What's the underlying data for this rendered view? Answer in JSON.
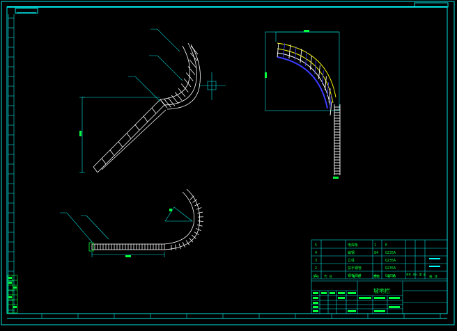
{
  "drawing": {
    "title_block_title": "坡地栏",
    "colors": {
      "background": "#000000",
      "frame": "#00e5e5",
      "line": "#ffffff",
      "text": "#00ff3c",
      "accent_yellow": "#ffff00",
      "accent_blue": "#3a3aff",
      "accent_cyan": "#00ffff"
    }
  },
  "bom": {
    "rows": [
      {
        "no": "5",
        "name": "电焊条",
        "qty": "1",
        "material": "E",
        "note": ""
      },
      {
        "no": "4",
        "name": "扁钢",
        "qty": "84",
        "material": "Q235A",
        "note": ""
      },
      {
        "no": "3",
        "name": "立柱",
        "qty": "",
        "material": "Q235A",
        "note": ""
      },
      {
        "no": "2",
        "name": "扶手钢管",
        "qty": "",
        "material": "Q235A",
        "note": ""
      },
      {
        "no": "1",
        "name": "钢板焊件",
        "qty": "4e",
        "material": "Q235A",
        "note": ""
      }
    ],
    "header": {
      "no": "序号",
      "code": "代 号",
      "name": "名 称",
      "qty": "数量",
      "material": "材 料",
      "weight": "单件 总计 重 量",
      "note": "备 注"
    }
  }
}
